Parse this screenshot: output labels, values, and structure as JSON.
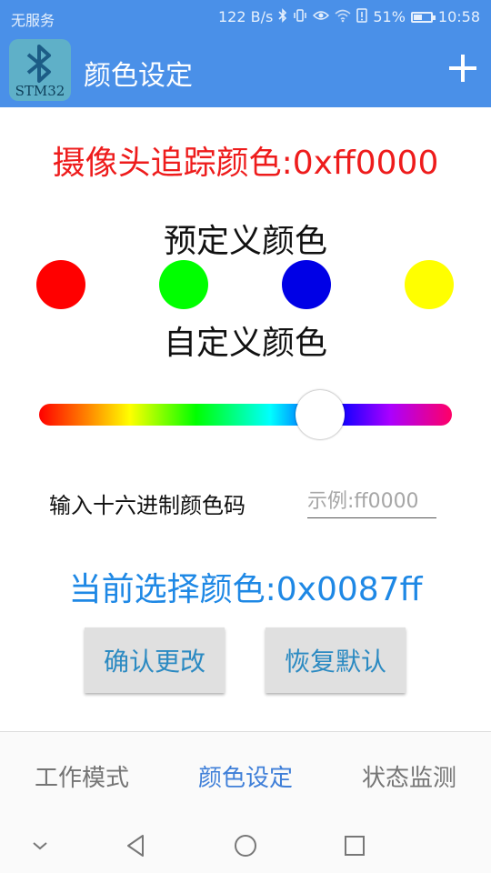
{
  "status_bar": {
    "carrier": "无服务",
    "net_speed": "122 B/s",
    "battery": "51%",
    "battery_level": 0.51,
    "time": "10:58",
    "icons": [
      "bluetooth-icon",
      "vibrate-icon",
      "eye-icon",
      "wifi-icon",
      "alert-icon",
      "battery-icon"
    ]
  },
  "app_bar": {
    "logo_text": "STM32",
    "title": "颜色设定",
    "add_icon": "plus-icon"
  },
  "tracking_color": "摄像头追踪颜色:0xff0000",
  "preset": {
    "title": "预定义颜色",
    "colors": [
      "#ff0000",
      "#00ff00",
      "#0000e6",
      "#ffff00"
    ]
  },
  "custom": {
    "title": "自定义颜色",
    "slider_position": 0.68
  },
  "hex_input": {
    "label": "输入十六进制颜色码",
    "placeholder": "示例:ff0000",
    "value": ""
  },
  "current_color": "当前选择颜色:0x0087ff",
  "buttons": {
    "confirm": "确认更改",
    "reset": "恢复默认"
  },
  "tabs": [
    {
      "label": "工作模式",
      "active": false
    },
    {
      "label": "颜色设定",
      "active": true
    },
    {
      "label": "状态监测",
      "active": false
    }
  ],
  "colors": {
    "primary": "#4a90e8",
    "tracking_text": "#ee1c1c",
    "current_text": "#1e88e5",
    "button_text": "#2b8ac2"
  }
}
